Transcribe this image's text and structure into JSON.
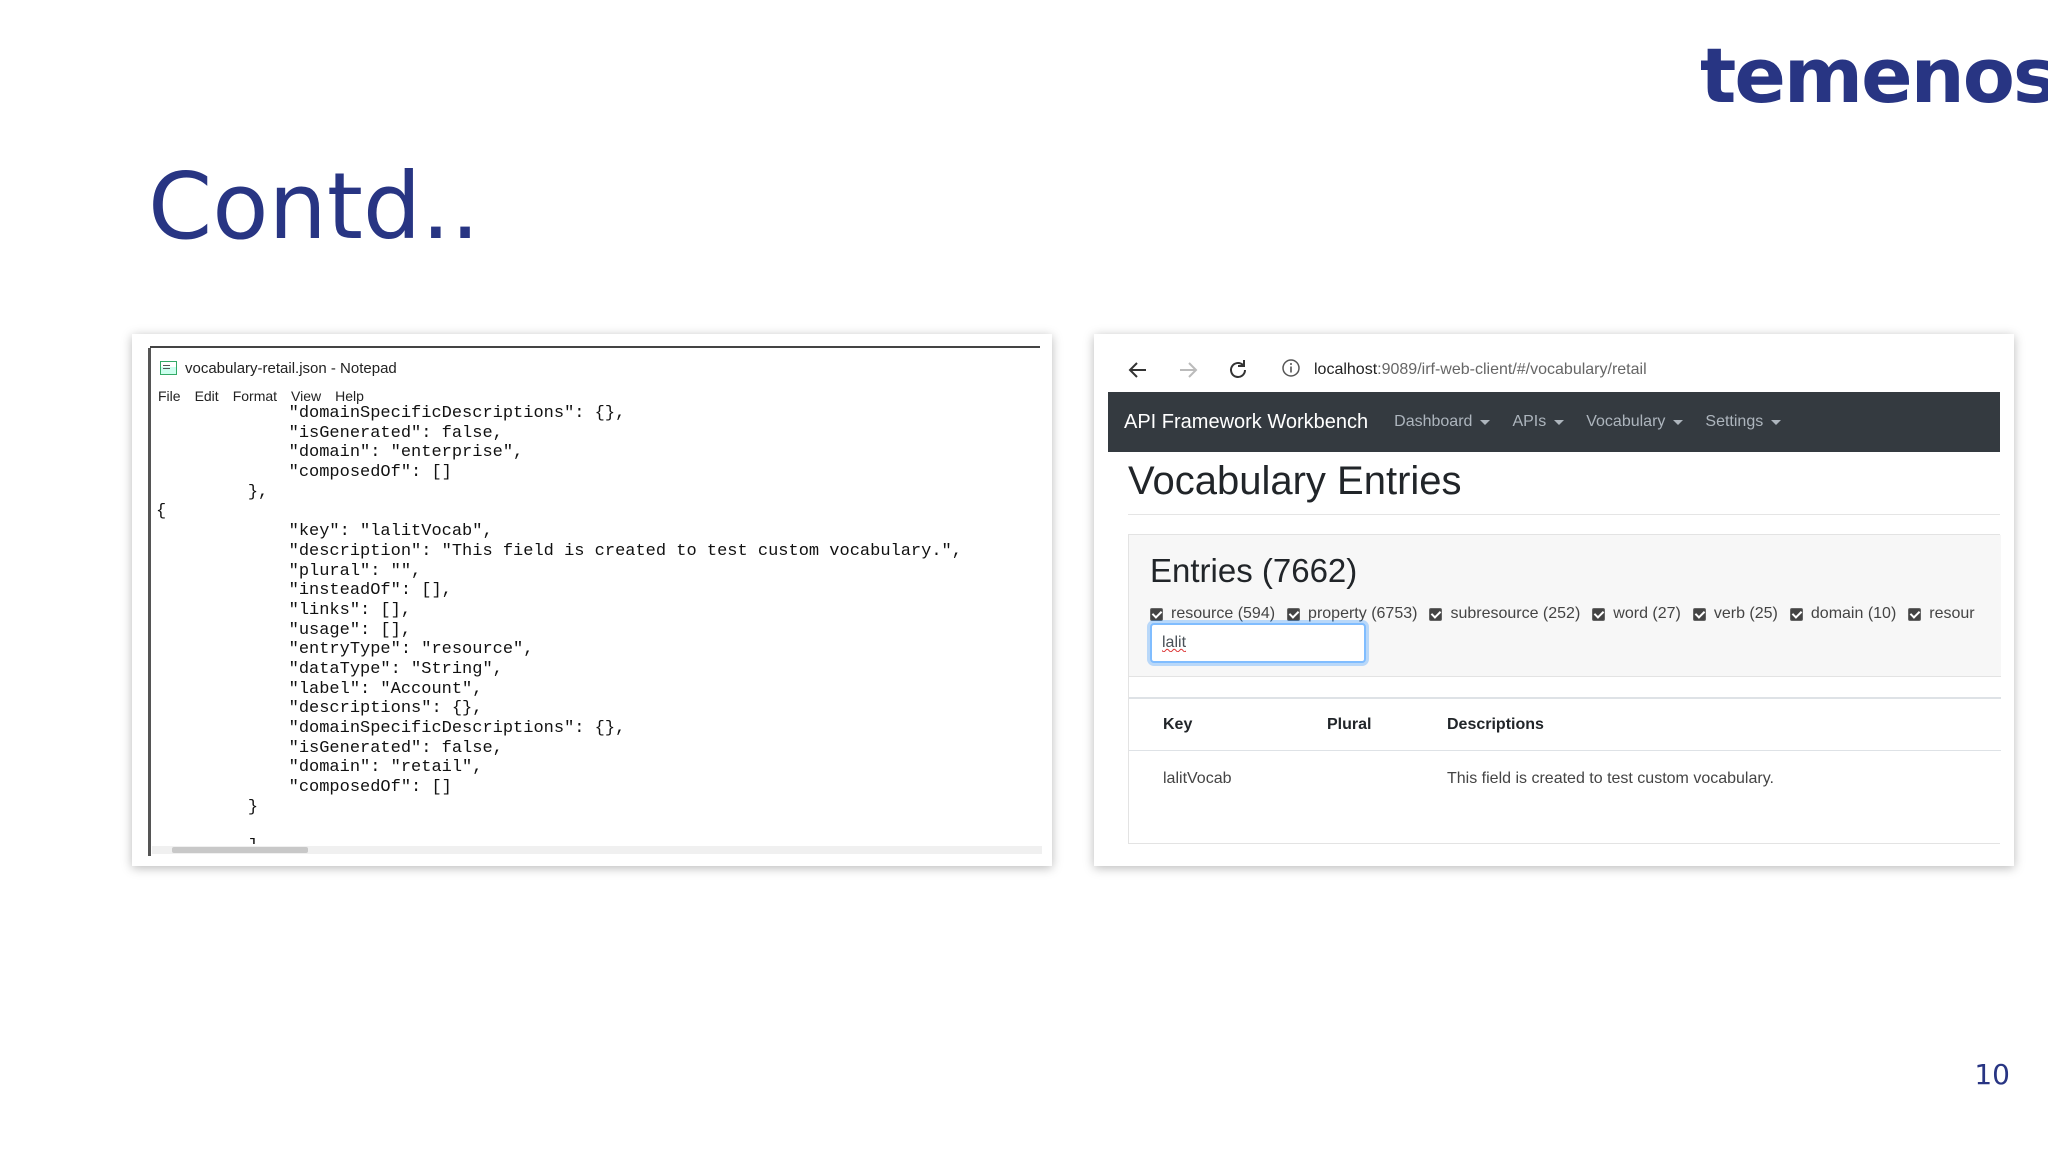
{
  "slide": {
    "logo_text": "temenos",
    "title": "Contd..",
    "page_number": "10",
    "brand_color": "#283583"
  },
  "notepad": {
    "window_title": "vocabulary-retail.json - Notepad",
    "menu": [
      "File",
      "Edit",
      "Format",
      "View",
      "Help"
    ],
    "lines": [
      "             \"domainSpecificDescriptions\": {},",
      "             \"isGenerated\": false,",
      "             \"domain\": \"enterprise\",",
      "             \"composedOf\": []",
      "         },",
      "{",
      "             \"key\": \"lalitVocab\",",
      "             \"description\": \"This field is created to test custom vocabulary.\",",
      "             \"plural\": \"\",",
      "             \"insteadOf\": [],",
      "             \"links\": [],",
      "             \"usage\": [],",
      "             \"entryType\": \"resource\",",
      "             \"dataType\": \"String\",",
      "             \"label\": \"Account\",",
      "             \"descriptions\": {},",
      "             \"domainSpecificDescriptions\": {},",
      "             \"isGenerated\": false,",
      "             \"domain\": \"retail\",",
      "             \"composedOf\": []",
      "         }",
      "",
      "         ]"
    ]
  },
  "browser": {
    "address_host": "localhost",
    "address_path": ":9089/irf-web-client/#/vocabulary/retail",
    "icons": [
      "back-arrow-icon",
      "forward-arrow-icon",
      "reload-icon",
      "info-icon"
    ],
    "navbar": {
      "brand": "API Framework Workbench",
      "menus": [
        "Dashboard",
        "APIs",
        "Vocabulary",
        "Settings"
      ]
    },
    "page_heading": "Vocabulary Entries",
    "entries_title": "Entries (7662)",
    "filters": [
      "resource (594)",
      "property (6753)",
      "subresource (252)",
      "word (27)",
      "verb (25)",
      "domain (10)",
      "resour"
    ],
    "search_value": "lalit",
    "table": {
      "headers": [
        "Key",
        "Plural",
        "Descriptions"
      ],
      "rows": [
        [
          "lalitVocab",
          "",
          "This field is created to test custom vocabulary."
        ]
      ]
    }
  }
}
